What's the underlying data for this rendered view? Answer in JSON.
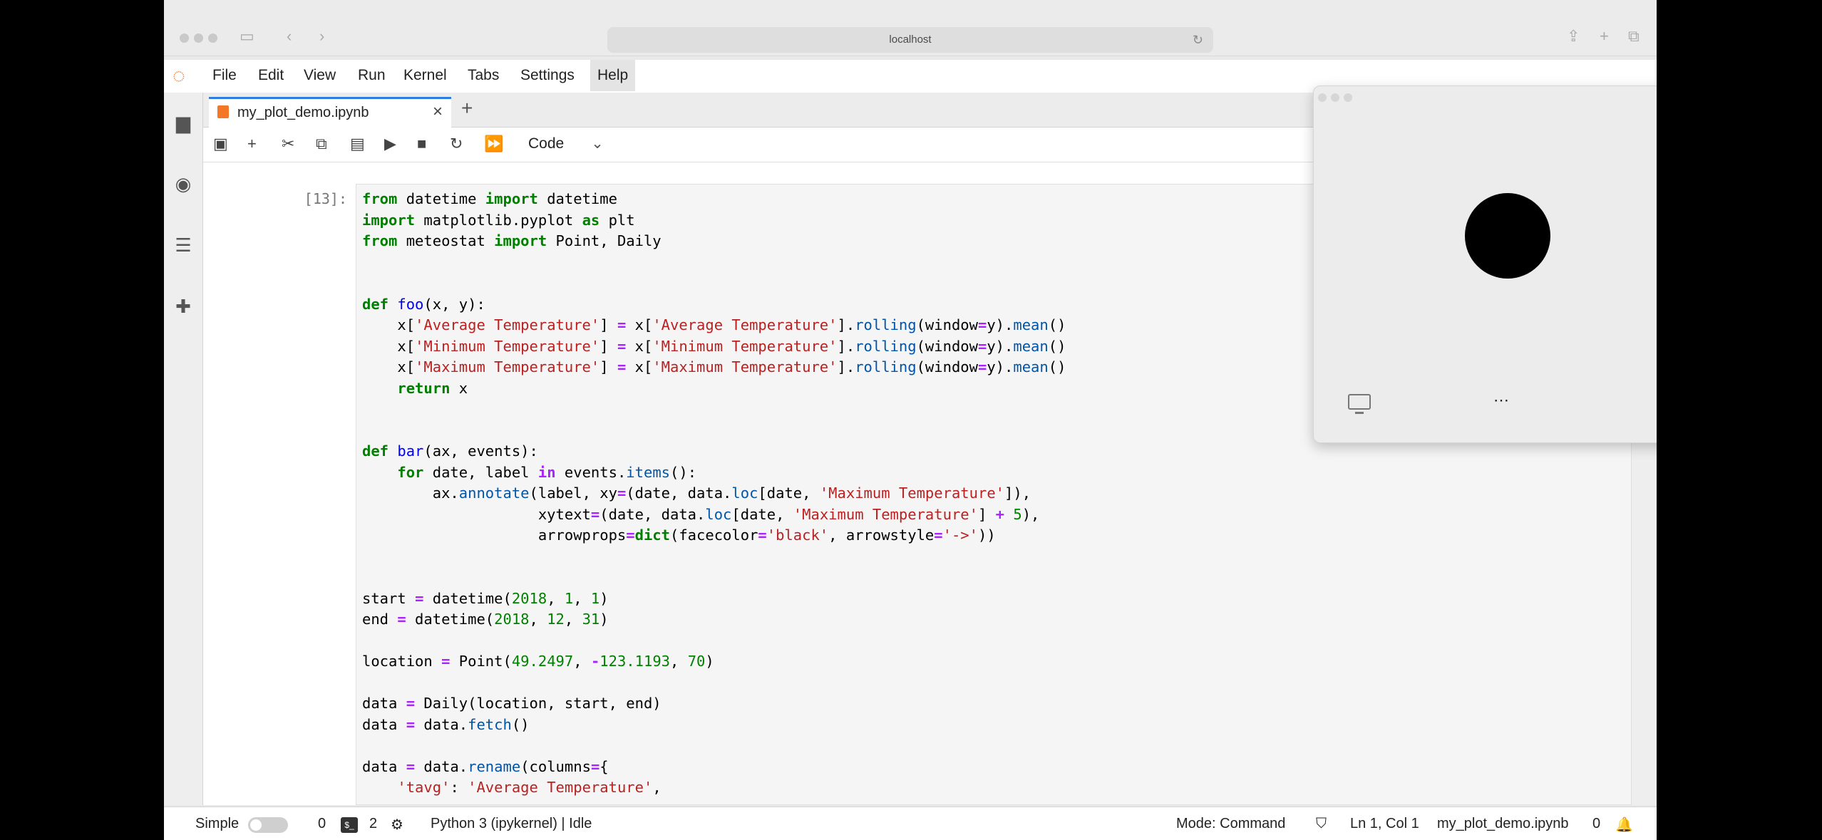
{
  "browser": {
    "url": "localhost"
  },
  "menu": {
    "items": [
      "File",
      "Edit",
      "View",
      "Run",
      "Kernel",
      "Tabs",
      "Settings",
      "Help"
    ]
  },
  "tab": {
    "title": "my_plot_demo.ipynb",
    "close": "×",
    "add": "+"
  },
  "toolbar": {
    "cell_type": "Code"
  },
  "cell": {
    "prompt": "[13]:"
  },
  "statusbar": {
    "mode_label": "Simple",
    "terminals": "0",
    "kernels": "2",
    "kernel": "Python 3 (ipykernel) | Idle",
    "mode": "Mode: Command",
    "position": "Ln 1, Col 1",
    "file": "my_plot_demo.ipynb",
    "notifications": "0"
  },
  "colors": {
    "accent": "#f37726",
    "active_tab": "#2f7de1"
  },
  "icons": [
    "folder-icon",
    "running-icon",
    "toc-icon",
    "extension-icon",
    "settings-icon",
    "debug-icon",
    "save-icon",
    "plus-icon",
    "cut-icon",
    "copy-icon",
    "paste-icon",
    "run-icon",
    "stop-icon",
    "restart-icon",
    "fast-forward-icon",
    "bell-icon",
    "shield-icon",
    "monitor-icon"
  ]
}
